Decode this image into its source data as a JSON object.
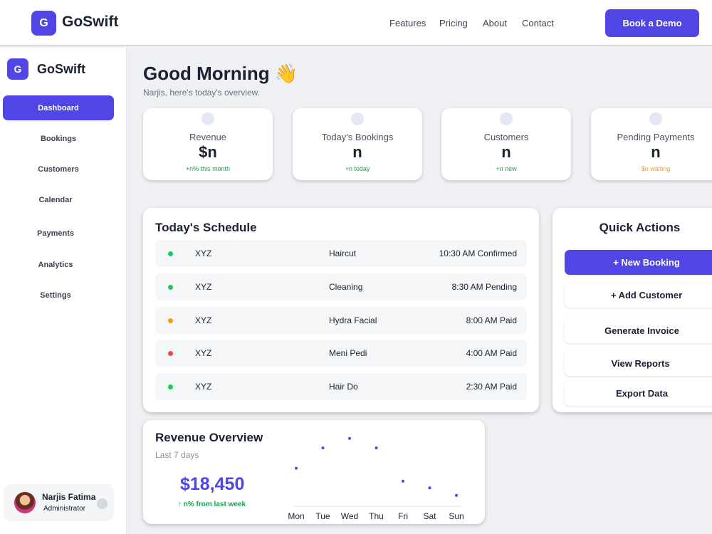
{
  "topnav": {
    "logo_letter": "G",
    "brand": "GoSwift",
    "links": [
      "Features",
      "Pricing",
      "About",
      "Contact"
    ],
    "cta": "Book a Demo"
  },
  "sidebar": {
    "logo_letter": "G",
    "brand": "GoSwift",
    "items": [
      {
        "label": "Dashboard",
        "active": true
      },
      {
        "label": "Bookings",
        "active": false
      },
      {
        "label": "Customers",
        "active": false
      },
      {
        "label": "Calendar",
        "active": false
      },
      {
        "label": "Payments",
        "active": false
      },
      {
        "label": "Analytics",
        "active": false
      },
      {
        "label": "Settings",
        "active": false
      }
    ],
    "profile": {
      "name": "Narjis Fatima",
      "role": "Administrator"
    }
  },
  "greeting": {
    "title": "Good Morning 👋",
    "subtitle": "Narjis, here's today's overview."
  },
  "stats": [
    {
      "label": "Revenue",
      "value": "$n",
      "sub": "+n% this month",
      "sub_color": "#16a34a"
    },
    {
      "label": "Today's Bookings",
      "value": "n",
      "sub": "+n today",
      "sub_color": "#16a34a"
    },
    {
      "label": "Customers",
      "value": "n",
      "sub": "+n new",
      "sub_color": "#16a34a"
    },
    {
      "label": "Pending Payments",
      "value": "n",
      "sub": "$n waiting",
      "sub_color": "#f59e0b"
    }
  ],
  "schedule": {
    "title": "Today's Schedule",
    "rows": [
      {
        "name": "XYZ",
        "service": "Haircut",
        "time": "10:30 AM Confirmed",
        "dot_color": "#22c55e"
      },
      {
        "name": "XYZ",
        "service": "Cleaning",
        "time": "8:30 AM Pending",
        "dot_color": "#22c55e"
      },
      {
        "name": "XYZ",
        "service": "Hydra Facial",
        "time": "8:00 AM Paid",
        "dot_color": "#f59e0b"
      },
      {
        "name": "XYZ",
        "service": "Meni Pedi",
        "time": "4:00 AM Paid",
        "dot_color": "#ef4444"
      },
      {
        "name": "XYZ",
        "service": "Hair Do",
        "time": "2:30 AM Paid",
        "dot_color": "#22c55e"
      }
    ]
  },
  "quick_actions": {
    "title": "Quick Actions",
    "buttons": [
      "+ New Booking",
      "+ Add Customer",
      "Generate Invoice",
      "View Reports",
      "Export Data"
    ]
  },
  "revenue": {
    "title": "Revenue Overview",
    "subtitle": "Last 7 days",
    "value": "$18,450",
    "change": "↑ n% from last week"
  },
  "chart_data": {
    "type": "scatter",
    "categories": [
      "Mon",
      "Tue",
      "Wed",
      "Thu",
      "Fri",
      "Sat",
      "Sun"
    ],
    "values": [
      0.56,
      0.86,
      1.0,
      0.86,
      0.37,
      0.27,
      0.16
    ],
    "ylim": [
      0,
      1.05
    ],
    "point_color": "#4f46e5"
  }
}
